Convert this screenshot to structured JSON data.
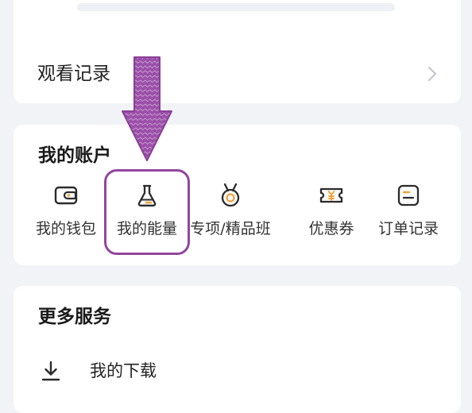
{
  "history": {
    "label": "观看记录"
  },
  "account": {
    "title": "我的账户",
    "items": [
      {
        "label": "我的钱包",
        "icon": "wallet-icon"
      },
      {
        "label": "我的能量",
        "icon": "flask-icon"
      },
      {
        "label": "专项/精品班",
        "icon": "medal-icon"
      },
      {
        "label": "优惠券",
        "icon": "coupon-icon"
      },
      {
        "label": "订单记录",
        "icon": "order-card-icon"
      }
    ]
  },
  "more_services": {
    "title": "更多服务",
    "items": [
      {
        "label": "我的下载",
        "icon": "download-icon"
      }
    ]
  },
  "annotation": {
    "highlight_color": "#93459e",
    "arrow_color": "#9a4fa8"
  },
  "colors": {
    "icon_stroke": "#2b2b2b",
    "icon_accent": "#f0a23a",
    "background": "#f2f3f7",
    "card": "#ffffff"
  }
}
